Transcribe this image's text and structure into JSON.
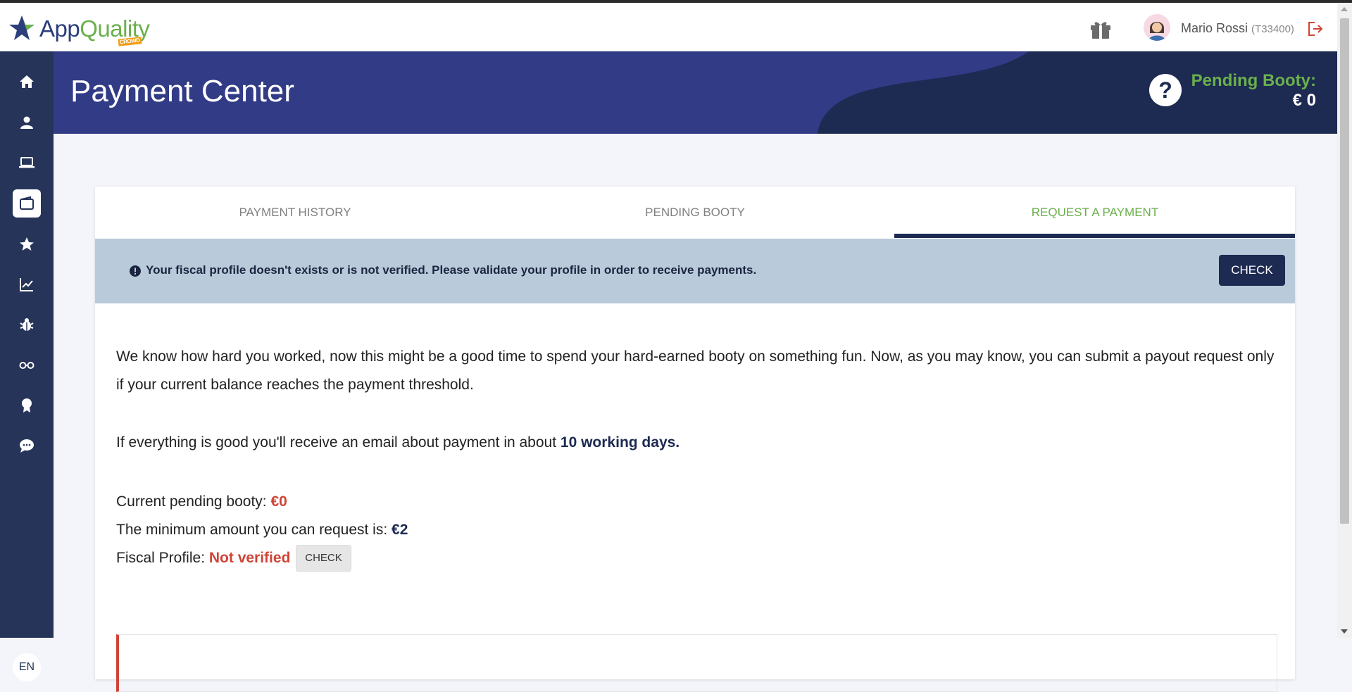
{
  "brand": {
    "logo_app": "App",
    "logo_quality": "Quality",
    "logo_crowd": "CROWD"
  },
  "topbar": {
    "user_name": "Mario Rossi",
    "user_code": "(T33400)"
  },
  "header": {
    "title": "Payment Center",
    "pending_label": "Pending Booty:",
    "pending_value": "€ 0"
  },
  "sidebar": {
    "items": [
      {
        "icon": "home-icon"
      },
      {
        "icon": "user-icon"
      },
      {
        "icon": "laptop-icon"
      },
      {
        "icon": "wallet-icon",
        "active": true
      },
      {
        "icon": "star-icon"
      },
      {
        "icon": "chart-icon"
      },
      {
        "icon": "bug-icon"
      },
      {
        "icon": "glasses-icon"
      },
      {
        "icon": "award-icon"
      },
      {
        "icon": "chat-icon"
      }
    ],
    "language": "EN"
  },
  "tabs": [
    {
      "label": "PAYMENT HISTORY",
      "active": false
    },
    {
      "label": "PENDING BOOTY",
      "active": false
    },
    {
      "label": "REQUEST A PAYMENT",
      "active": true
    }
  ],
  "alert": {
    "text": "Your fiscal profile doesn't exists or is not verified. Please validate your profile in order to receive payments.",
    "button": "CHECK"
  },
  "content": {
    "intro": "We know how hard you worked, now this might be a good time to spend your hard-earned booty on something fun. Now, as you may know, you can submit a payout request only if your current balance reaches the payment threshold.",
    "email_prefix": "If everything is good you'll receive an email about payment in about",
    "email_days": "10 working days.",
    "pending_label": "Current pending booty:",
    "pending_value": "€0",
    "minimum_label": "The minimum amount you can request is:",
    "minimum_value": "€2",
    "fiscal_label": "Fiscal Profile:",
    "fiscal_status": "Not verified",
    "fiscal_button": "CHECK"
  },
  "colors": {
    "sidebar": "#263459",
    "header": "#323b86",
    "header_dark": "#1d2a52",
    "accent_green": "#6ab04c",
    "alert_bg": "#b9cbda",
    "error_red": "#d04437"
  }
}
